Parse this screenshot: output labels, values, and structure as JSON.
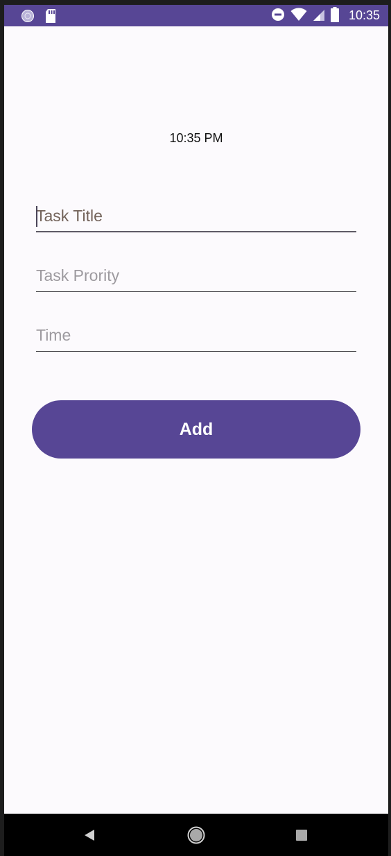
{
  "status_bar": {
    "time": "10:35",
    "bg_color": "#574695",
    "icons": [
      "activity-icon",
      "sd-card-icon",
      "do-not-disturb-icon",
      "wifi-icon",
      "signal-icon",
      "battery-icon"
    ]
  },
  "main": {
    "time_display": "10:35 PM",
    "fields": {
      "title": {
        "placeholder": "Task Title",
        "value": ""
      },
      "priority": {
        "placeholder": "Task Prority",
        "value": ""
      },
      "time": {
        "placeholder": "Time",
        "value": ""
      }
    },
    "add_button_label": "Add",
    "accent_color": "#574695"
  },
  "nav_bar": {
    "icons": [
      "back-icon",
      "home-icon",
      "recents-icon"
    ]
  }
}
